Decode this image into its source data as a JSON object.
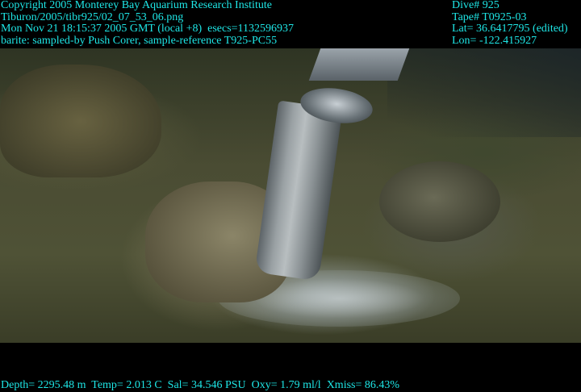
{
  "overlay_top_left": [
    "Copyright 2005 Monterey Bay Aquarium Research Institute",
    "Tiburon/2005/tibr925/02_07_53_06.png",
    "Mon Nov 21 18:15:37 2005 GMT (local +8)  esecs=1132596937",
    "barite: sampled-by Push Corer, sample-reference T925-PC55"
  ],
  "overlay_top_right": [
    "Dive# 925",
    "Tape# T0925-03",
    "Lat= 36.6417795 (edited)",
    "Lon= -122.415927"
  ],
  "overlay_bottom": "Depth= 2295.48 m  Temp= 2.013 C  Sal= 34.546 PSU  Oxy= 1.79 ml/l  Xmiss= 86.43%",
  "colors": {
    "overlay_text": "#1ee6e6"
  }
}
